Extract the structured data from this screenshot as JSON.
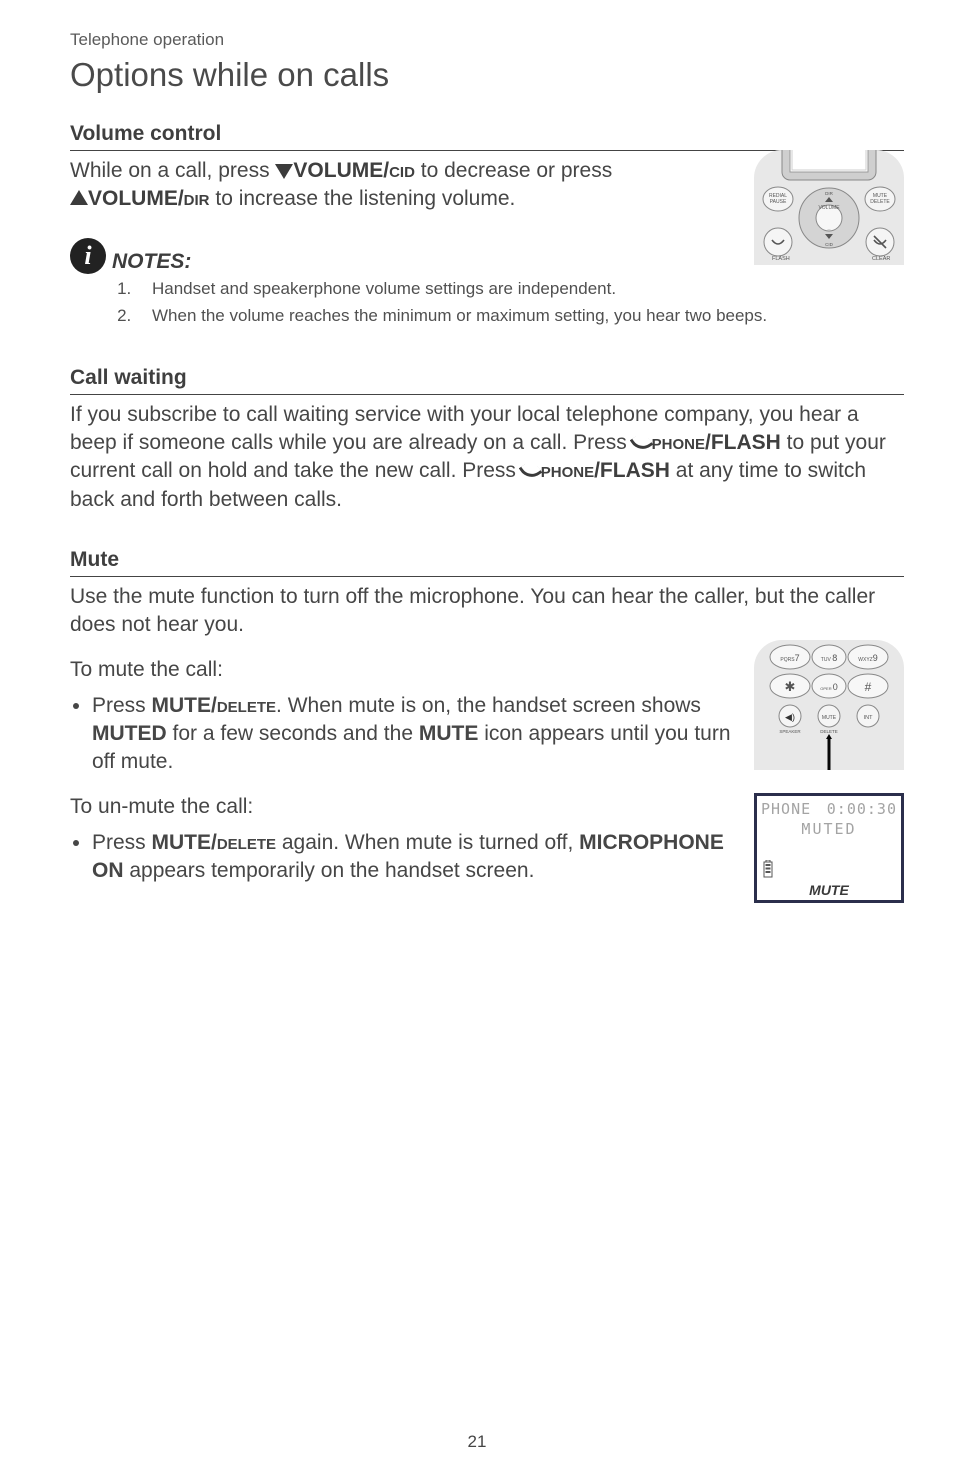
{
  "header": {
    "category": "Telephone operation",
    "title": "Options while on calls"
  },
  "volume": {
    "heading": "Volume control",
    "line1_pre": "While on a call, press ",
    "vol_cid": "VOLUME/",
    "vol_cid_sc": "cid",
    "line1_post": " to decrease or press ",
    "vol_dir": "VOLUME/",
    "vol_dir_sc": "dir",
    "line2_post": " to increase the listening volume."
  },
  "notes": {
    "label": "NOTES",
    "items": [
      "Handset and speakerphone volume settings are independent.",
      "When the volume reaches the minimum or maximum setting, you hear two beeps."
    ]
  },
  "call_waiting": {
    "heading": "Call waiting",
    "p_pre": "If you subscribe to call waiting service with your local telephone company, you hear a beep if someone calls while you are already on a call. Press ",
    "phone_sc": "phone",
    "flash": "/FLASH",
    "p_mid": " to put your current call on hold and take the new call. Press ",
    "p_end": " at any time to switch back and forth between calls."
  },
  "mute": {
    "heading": "Mute",
    "p1": "Use the mute function to turn off the microphone. You can hear the caller, but the caller does not hear you.",
    "sub1": "To mute the call:",
    "bullet1_pre": "Press ",
    "mute_del": "MUTE/",
    "delete_sc": "delete",
    "bullet1_mid": ". When mute is on, the handset screen shows ",
    "muted": "MUTED",
    "bullet1_mid2": " for a few seconds and the ",
    "mute_word": "MUTE",
    "bullet1_post": " icon appears until you turn off mute.",
    "sub2": "To un-mute the call:",
    "bullet2_pre": "Press ",
    "bullet2_mid": " again. When mute is turned off, ",
    "mic_on": "MICROPHONE ON",
    "bullet2_post": " appears temporarily on the handset screen."
  },
  "lcd": {
    "phone_label": "PHONE",
    "time": "0:00:30",
    "muted": "MUTED",
    "mute_foot": "MUTE"
  },
  "illus1": {
    "redial": "REDIAL",
    "pause": "PAUSE",
    "mute": "MUTE",
    "delete": "DELETE",
    "volume": "VOLUME",
    "flash": "FLASH",
    "clear": "CLEAR",
    "dir": "DIR",
    "cid": "CID"
  },
  "illus2": {
    "k7": "PQRS7",
    "k8": "TUV 8",
    "k9": "WXYZ9",
    "star": "✱",
    "k0": "OPER 0",
    "hash": "#",
    "spk": "◀",
    "mute": "MUTE",
    "int": "INT",
    "speaker": "SPEAKER",
    "delete": "DELETE"
  },
  "page_number": "21"
}
